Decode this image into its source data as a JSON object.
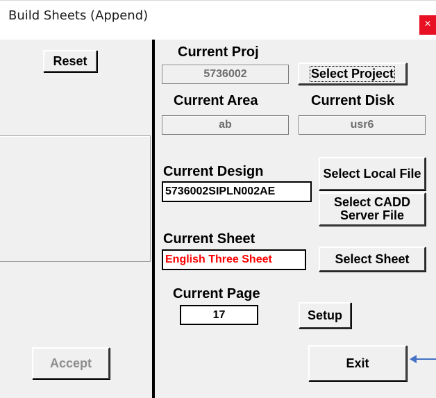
{
  "window": {
    "title": "Build Sheets (Append)",
    "close_glyph": "×"
  },
  "left": {
    "reset_label": "Reset",
    "accept_label": "Accept"
  },
  "project": {
    "label": "Current Proj",
    "value": "5736002",
    "select_label": "Select Project"
  },
  "area": {
    "label": "Current Area",
    "value": "ab"
  },
  "disk": {
    "label": "Current Disk",
    "value": "usr6"
  },
  "design": {
    "label": "Current  Design",
    "value": "5736002SIPLN002AE",
    "select_local_label": "Select Local File",
    "select_cadd_label": "Select CADD Server File"
  },
  "sheet": {
    "label": "Current Sheet",
    "value": "English Three Sheet",
    "value_color": "#ff0000",
    "select_label": "Select Sheet"
  },
  "page": {
    "label": "Current Page",
    "value": "17",
    "setup_label": "Setup"
  },
  "exit_label": "Exit",
  "colors": {
    "close_bg": "#e81123",
    "arrow": "#4472c4",
    "divider": "#000000"
  }
}
